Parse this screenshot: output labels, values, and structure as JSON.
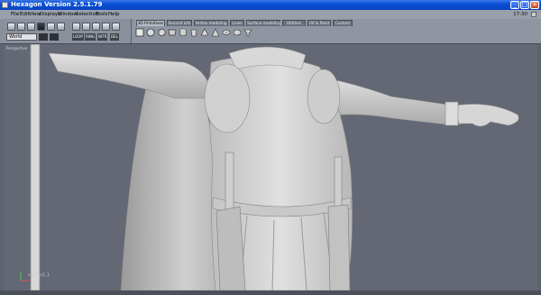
{
  "window": {
    "title": "Hexagon Version 2.5.1.79",
    "clock": "17:30"
  },
  "menu": [
    "File",
    "Edit",
    "View",
    "Displays",
    "Window",
    "Selection",
    "Tools",
    "Help"
  ],
  "tool_panel": {
    "mode_select": "World",
    "options": [
      "LOOP",
      "RING",
      "INTR",
      "DEL"
    ]
  },
  "tabs": [
    {
      "label": "3D Primitives",
      "active": true
    },
    {
      "label": "Second Life",
      "active": false
    },
    {
      "label": "Vertex modeling",
      "active": false
    },
    {
      "label": "Lines",
      "active": false
    },
    {
      "label": "Surface modeling",
      "active": false
    },
    {
      "label": "Utilities",
      "active": false
    },
    {
      "label": "UV & Paint",
      "active": false
    },
    {
      "label": "Custom",
      "active": false
    }
  ],
  "viewport": {
    "label": "Perspective",
    "axis_label": "x_cahn2_1"
  },
  "colors": {
    "titlebar": "#0a4fd6",
    "viewport_bg": "#636874",
    "model": "#d4d4d4"
  }
}
